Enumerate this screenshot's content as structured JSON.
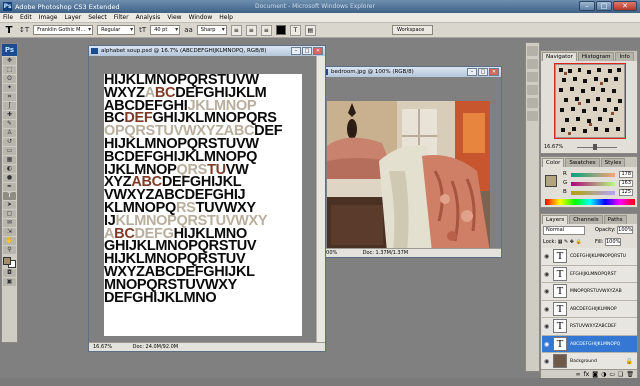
{
  "app": {
    "title": "Adobe Photoshop CS3 Extended",
    "document_hint": "Document - Microsoft Windows Explorer"
  },
  "window_controls": {
    "minimize": "–",
    "maximize": "□",
    "close": "✕"
  },
  "menu": [
    "File",
    "Edit",
    "Image",
    "Layer",
    "Select",
    "Filter",
    "Analysis",
    "View",
    "Window",
    "Help"
  ],
  "options_bar": {
    "tool_glyph": "T",
    "orientation_glyph": "↕T",
    "font_family": "Franklin Gothic M...",
    "font_style": "Regular",
    "size_glyph": "tT",
    "font_size": "40 pt",
    "aa_glyph": "aa",
    "antialias": "Sharp",
    "workspace": "Workspace"
  },
  "toolbox": {
    "logo": "Ps",
    "fg_color": "#a38e6a",
    "bg_color": "#ffffff"
  },
  "doc_alpha": {
    "title": "alphabet soup.psd @ 16.7% (ABCDEFGHIJKLMNOPQ, RGB/8)",
    "zoom": "16.67%",
    "docsize": "Doc: 24.0M/92.0M",
    "rows": [
      [
        [
          "a",
          "HIJKLMNOPQRSTUVW"
        ]
      ],
      [
        [
          "a",
          "WXYZ"
        ],
        [
          "c",
          "A"
        ],
        [
          "b",
          "BC"
        ],
        [
          "a",
          "DEFGHIJKLM"
        ]
      ],
      [
        [
          "a",
          "ABCDEFGHI"
        ],
        [
          "c",
          "JKLMNOP"
        ]
      ],
      [
        [
          "a",
          "BC"
        ],
        [
          "b",
          "DEF"
        ],
        [
          "a",
          "GHIJKLMNOPQRS"
        ]
      ],
      [
        [
          "c",
          "OPQRSTUVWXYZABC"
        ],
        [
          "a",
          "DEF"
        ]
      ],
      [
        [
          "a",
          "HIJKLMNOPQRSTUVW"
        ]
      ],
      [
        [
          "a",
          "BCDEFGHIJKLMNOPQ"
        ]
      ],
      [
        [
          "a",
          "IJKLMNOP"
        ],
        [
          "c",
          "QRS"
        ],
        [
          "b",
          "TU"
        ],
        [
          "a",
          "VW"
        ]
      ],
      [
        [
          "a",
          "XYZ"
        ],
        [
          "b",
          "ABC"
        ],
        [
          "a",
          "DEFGHIJKL"
        ]
      ],
      [
        [
          "a",
          "VWXYZABCDEFGHIJ"
        ]
      ],
      [
        [
          "a",
          "KLMNOPQ"
        ],
        [
          "c",
          "RS"
        ],
        [
          "a",
          "TUVWXY"
        ]
      ],
      [
        [
          "a",
          "IJ"
        ],
        [
          "c",
          "KLMNOPQRSTUVWXY"
        ]
      ],
      [
        [
          "c",
          "A"
        ],
        [
          "b",
          "BC"
        ],
        [
          "c",
          "DEFG"
        ],
        [
          "a",
          "HIJKLMNO"
        ]
      ],
      [
        [
          "a",
          "GHIJKLMNOPQRSTUV"
        ]
      ],
      [
        [
          "a",
          "HIJKLMNOPQRSTUV"
        ]
      ],
      [
        [
          "a",
          "WXYZABCDEFGHIJKL"
        ]
      ],
      [
        [
          "a",
          "MNOPQRSTUVWXY"
        ]
      ],
      [
        [
          "a",
          "DEFGHIJKLMNO"
        ]
      ]
    ]
  },
  "doc_photo": {
    "title": "bedroom.jpg @ 100% (RGB/8)",
    "zoom": "100%",
    "docsize": "Doc: 1.37M/1.37M"
  },
  "navigator": {
    "tabs": [
      "Navigator",
      "Histogram",
      "Info"
    ],
    "zoom": "16.67%"
  },
  "color_panel": {
    "tabs": [
      "Color",
      "Swatches",
      "Styles"
    ],
    "channels": [
      {
        "label": "R",
        "value": "178"
      },
      {
        "label": "G",
        "value": "163"
      },
      {
        "label": "B",
        "value": "125"
      }
    ],
    "sample": "#b2a47f"
  },
  "layers_panel": {
    "tabs": [
      "Layers",
      "Channels",
      "Paths"
    ],
    "blend_mode": "Normal",
    "opacity_label": "Opacity:",
    "opacity": "100%",
    "lock_label": "Lock:",
    "fill_label": "Fill:",
    "fill": "100%",
    "layers": [
      {
        "name": "CDEFGHIJKLMNOPQRSTU",
        "thumb": "T",
        "selected": false
      },
      {
        "name": "EFGHIJKLMNOPQRST",
        "thumb": "T",
        "selected": false
      },
      {
        "name": "MNOPQRSTUVWXYZAB",
        "thumb": "T",
        "selected": false
      },
      {
        "name": "ABCDEFGHIJKLMNOP",
        "thumb": "T",
        "selected": false
      },
      {
        "name": "RSTUVWXYZABCDEF",
        "thumb": "T",
        "selected": false
      },
      {
        "name": "ABCDEFGHIJKLMNOPQ",
        "thumb": "T",
        "selected": true
      },
      {
        "name": "Background",
        "thumb": "",
        "selected": false
      }
    ]
  }
}
